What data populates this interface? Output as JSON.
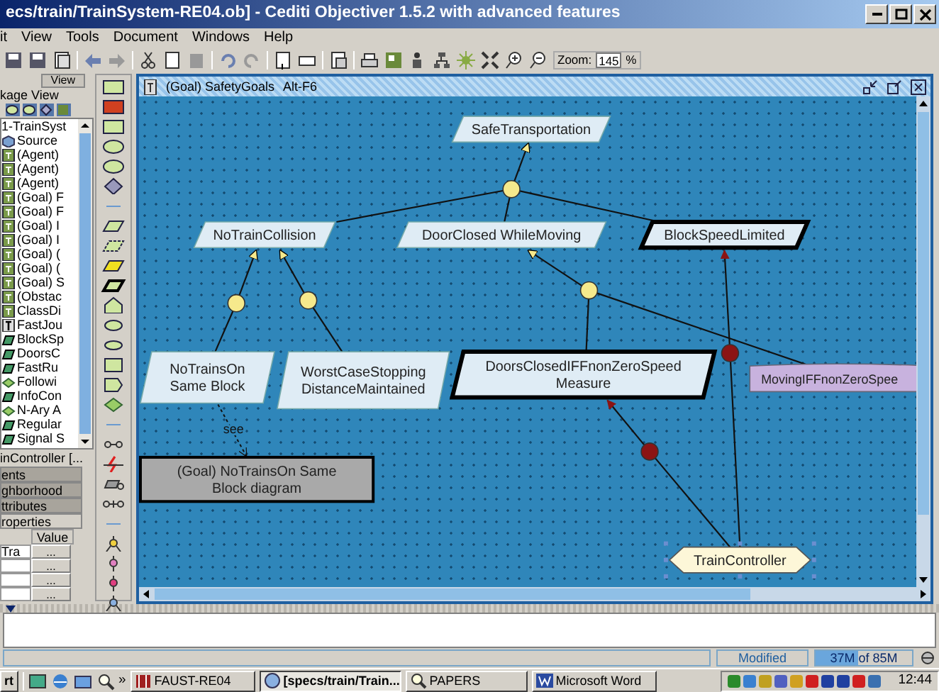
{
  "window": {
    "title": "ecs/train/TrainSystem-RE04.ob] - Cediti Objectiver 1.5.2 with advanced features"
  },
  "menu": [
    "it",
    "View",
    "Tools",
    "Document",
    "Windows",
    "Help"
  ],
  "toolbar": {
    "zoom_label": "Zoom:",
    "zoom_value": "145",
    "zoom_unit": "%"
  },
  "sidebar": {
    "tab": "View",
    "header": "kage View",
    "tree": [
      {
        "label": "1-TrainSyst",
        "kind": "root"
      },
      {
        "label": "Source",
        "kind": "package"
      },
      {
        "label": "(Agent)",
        "kind": "diagram"
      },
      {
        "label": "(Agent)",
        "kind": "diagram"
      },
      {
        "label": "(Agent)",
        "kind": "diagram"
      },
      {
        "label": "(Goal) F",
        "kind": "diagram"
      },
      {
        "label": "(Goal) F",
        "kind": "diagram"
      },
      {
        "label": "(Goal) I",
        "kind": "diagram"
      },
      {
        "label": "(Goal) I",
        "kind": "diagram"
      },
      {
        "label": "(Goal) (",
        "kind": "diagram"
      },
      {
        "label": "(Goal) (",
        "kind": "diagram"
      },
      {
        "label": "(Goal) S",
        "kind": "diagram"
      },
      {
        "label": "(Obstac",
        "kind": "diagram"
      },
      {
        "label": "ClassDi",
        "kind": "diagram"
      },
      {
        "label": "FastJou",
        "kind": "text"
      },
      {
        "label": "BlockSp",
        "kind": "goal"
      },
      {
        "label": "DoorsC",
        "kind": "goal"
      },
      {
        "label": "FastRu",
        "kind": "goal"
      },
      {
        "label": "Followi",
        "kind": "refinement"
      },
      {
        "label": "InfoCon",
        "kind": "goal"
      },
      {
        "label": "N-Ary A",
        "kind": "refinement"
      },
      {
        "label": "Regular",
        "kind": "goal"
      },
      {
        "label": "Signal S",
        "kind": "goal"
      }
    ],
    "selection": "inController  [...",
    "tabs": [
      {
        "label": "ents",
        "selected": false
      },
      {
        "label": "ghborhood",
        "selected": false
      },
      {
        "label": "ttributes",
        "selected": false
      },
      {
        "label": "roperties",
        "selected": true
      }
    ],
    "properties": {
      "column": "Value",
      "rows": [
        {
          "name": "Tra",
          "button": "..."
        },
        {
          "button": "..."
        },
        {
          "button": "..."
        },
        {
          "button": "..."
        }
      ]
    }
  },
  "diagram": {
    "title": "(Goal) SafetyGoals",
    "shortcut": "Alt-F6",
    "nodes": [
      {
        "kind": "goal",
        "lines": [
          "SafeTransportation"
        ],
        "selected": false
      },
      {
        "kind": "goal",
        "lines": [
          "NoTrainCollision"
        ],
        "selected": false
      },
      {
        "kind": "goal",
        "lines": [
          "DoorClosed WhileMoving"
        ],
        "selected": false
      },
      {
        "kind": "requirement",
        "lines": [
          "BlockSpeedLimited"
        ],
        "selected": false
      },
      {
        "kind": "goal",
        "lines": [
          "NoTrainsOn",
          "Same Block"
        ],
        "selected": false
      },
      {
        "kind": "goal",
        "lines": [
          "WorstCaseStopping",
          "DistanceMaintained"
        ],
        "selected": false
      },
      {
        "kind": "requirement",
        "lines": [
          "DoorsClosedIFFnonZeroSpeed",
          "Measure"
        ],
        "selected": false
      },
      {
        "kind": "expectation",
        "lines": [
          "MovingIFFnonZeroSpee"
        ],
        "selected": false
      },
      {
        "kind": "diagram-ref",
        "lines": [
          "(Goal) NoTrainsOn Same",
          "Block diagram"
        ],
        "selected": false
      },
      {
        "kind": "agent",
        "lines": [
          "TrainController"
        ],
        "selected": true
      }
    ],
    "links": [
      {
        "kind": "refinement"
      },
      {
        "kind": "refinement"
      },
      {
        "kind": "refinement"
      },
      {
        "kind": "refinement"
      },
      {
        "kind": "responsibility"
      },
      {
        "kind": "responsibility"
      },
      {
        "kind": "see",
        "label": "see"
      }
    ]
  },
  "status_bar": {
    "state": "Modified",
    "memory": {
      "text": "37M of 85M",
      "level": 0.44
    }
  },
  "taskbar": {
    "start": "rt",
    "more": "»",
    "tasks": [
      {
        "label": "FAUST-RE04",
        "selected": false
      },
      {
        "label": "[specs/train/Train...",
        "selected": true
      },
      {
        "label": "PAPERS",
        "selected": false
      },
      {
        "label": "Microsoft Word",
        "selected": false
      }
    ],
    "clock": "12:44"
  }
}
